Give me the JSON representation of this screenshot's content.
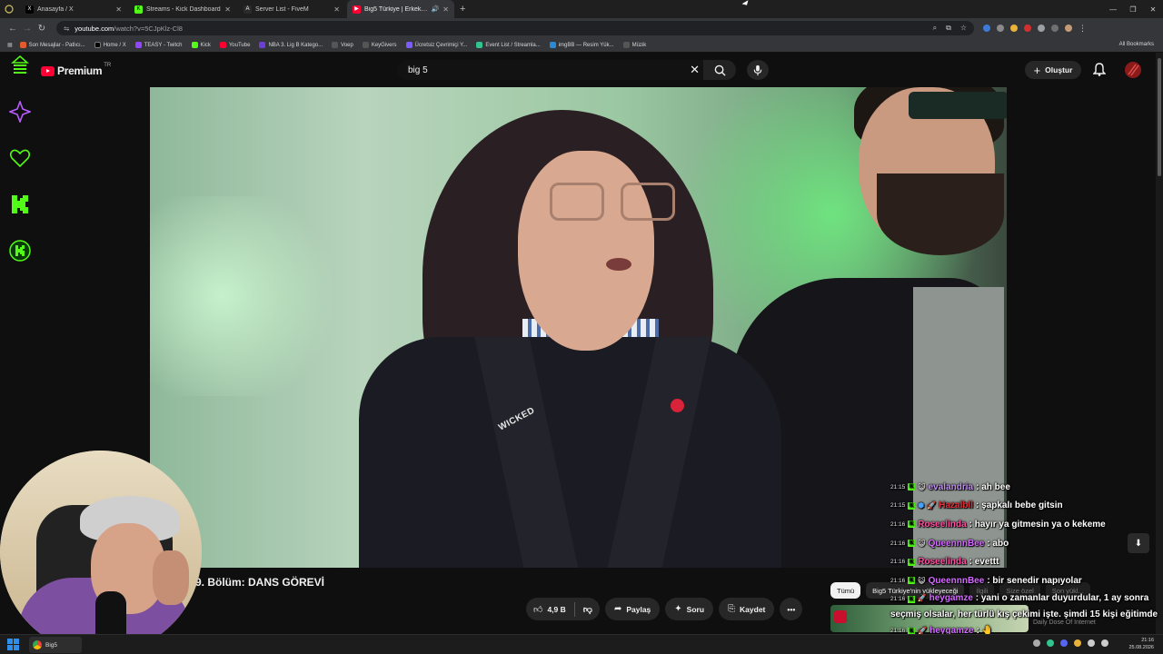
{
  "browser": {
    "tabs": [
      {
        "label": "Anasayfa / X",
        "color": "#000000",
        "glyph": "X"
      },
      {
        "label": "Streams - Kick Dashboard",
        "color": "#53fc18",
        "glyph": "K"
      },
      {
        "label": "Server List - FiveM",
        "color": "#2b2b2b",
        "glyph": "A"
      },
      {
        "label": "Big5 Türkiye | Erkek Hazırl...",
        "color": "#ff0033",
        "glyph": "▶"
      }
    ],
    "url_host": "youtube.com",
    "url_path": "/watch?v=5CJpKlz-Cl8",
    "bookmarks": [
      {
        "label": "Son Mesajlar - Patlıcı...",
        "color": "#e25b2c"
      },
      {
        "label": "Home / X",
        "color": "#000000"
      },
      {
        "label": "TEASY - Twitch",
        "color": "#9146ff"
      },
      {
        "label": "Kick",
        "color": "#53fc18"
      },
      {
        "label": "YouTube",
        "color": "#ff0033"
      },
      {
        "label": "NBA 3. Lig B Katego...",
        "color": "#6b3fd4"
      },
      {
        "label": "Voep",
        "color": "#555555"
      },
      {
        "label": "KeyGivers",
        "color": "#555555"
      },
      {
        "label": "Ücretsiz Çevrimiçi Y...",
        "color": "#7c5cff"
      },
      {
        "label": "Event List / Streamla...",
        "color": "#31c48d"
      },
      {
        "label": "imgBB — Resim Yük...",
        "color": "#2b8ad6"
      },
      {
        "label": "Müzik",
        "color": "#555555"
      }
    ],
    "all_bookmarks": "All Bookmarks"
  },
  "youtube": {
    "logo_text": "Premium",
    "country": "TR",
    "search_value": "big 5",
    "create_label": "Oluştur",
    "video_title": "9. Bölüm: DANS GÖREVİ",
    "video_badge": "WICKED",
    "like_count": "4,9 B",
    "share_label": "Paylaş",
    "ask_label": "Soru",
    "save_label": "Kaydet",
    "chips": [
      "Tümü",
      "Big5 Türkiye'nin yükleyeceği",
      "İlgili",
      "Size özel",
      "Son yükl..."
    ],
    "rec_channel": "Daily Dose Of Internet"
  },
  "chat": {
    "messages": [
      {
        "time": "21:15",
        "user": "evalandria",
        "color": "#c08ff0",
        "badge": "😺",
        "text": "ah bee"
      },
      {
        "time": "21:15",
        "user": "Hazalbll",
        "color": "#e0303a",
        "badge": "🚀",
        "text": "şapkalı bebe gitsin"
      },
      {
        "time": "21:16",
        "user": "Roseelinda",
        "color": "#ff4fa0",
        "badge": "",
        "text": "hayır ya gitmesin ya o kekeme"
      },
      {
        "time": "21:16",
        "user": "QueennnBee",
        "color": "#d46bff",
        "badge": "😺",
        "text": "abo"
      },
      {
        "time": "21:16",
        "user": "Roseelinda",
        "color": "#ff4fa0",
        "badge": "",
        "text": "evettt"
      },
      {
        "time": "21:16",
        "user": "QueennnBee",
        "color": "#d46bff",
        "badge": "😺",
        "text": "bir senedir napıyolar"
      },
      {
        "time": "21:16",
        "user": "heygamze",
        "color": "#d46bff",
        "badge": "🚀",
        "text": "yani o zamanlar duyurdular, 1 ay sonra seçmiş olsalar, her türlü kış çekimi işte. şimdi 15 kişi eğitimde"
      },
      {
        "time": "21:16",
        "user": "heygamze",
        "color": "#d46bff",
        "badge": "🚀",
        "text": "🤚"
      }
    ]
  },
  "taskbar": {
    "app_label": "Big5",
    "time": "21:16",
    "date": "25.08.2026"
  }
}
